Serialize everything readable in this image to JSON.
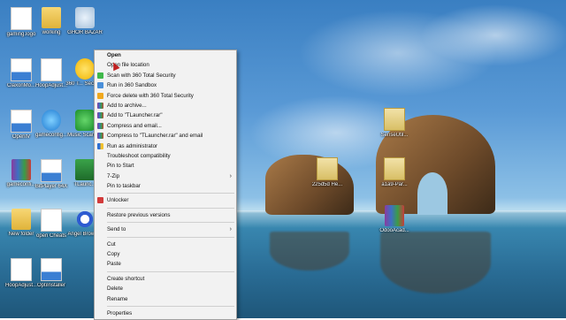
{
  "desktop": {
    "icons": [
      {
        "label": "gaming.logo"
      },
      {
        "label": "working"
      },
      {
        "label": "GHOR\nBAZAR"
      },
      {
        "label": "ClaxonMo..."
      },
      {
        "label": "HoopAdjust..."
      },
      {
        "label": "360 T... Securi..."
      },
      {
        "label": "OpenIV"
      },
      {
        "label": "gameconfig..."
      },
      {
        "label": "Music Scanner"
      },
      {
        "label": "gameconfi..."
      },
      {
        "label": "BitPlayer 64X"
      },
      {
        "label": "TLaunc..."
      },
      {
        "label": "New folder"
      },
      {
        "label": "open Cheats"
      },
      {
        "label": "Angel Browser"
      },
      {
        "label": "HoopAdjust..."
      },
      {
        "label": "OptiInstaller"
      },
      {
        "label": "SenseUtil..."
      },
      {
        "label": "225d5d He..."
      },
      {
        "label": "a1a9-Par..."
      },
      {
        "label": "OdooAcad..."
      }
    ]
  },
  "context_menu": {
    "items": [
      {
        "label": "Open",
        "bold": true
      },
      {
        "label": "Open file location"
      },
      {
        "label": "Scan with 360 Total Security"
      },
      {
        "label": "Run in 360 Sandbox"
      },
      {
        "label": "Force delete with 360 Total Security"
      },
      {
        "label": "Add to archive..."
      },
      {
        "label": "Add to \"TLauncher.rar\""
      },
      {
        "label": "Compress and email..."
      },
      {
        "label": "Compress to \"TLauncher.rar\" and email"
      },
      {
        "label": "Run as administrator"
      },
      {
        "label": "Troubleshoot compatibility"
      },
      {
        "label": "Pin to Start"
      },
      {
        "label": "7-Zip"
      },
      {
        "label": "Pin to taskbar"
      },
      {
        "label": "Unlocker"
      },
      {
        "label": "Restore previous versions"
      },
      {
        "label": "Send to"
      },
      {
        "label": "Cut"
      },
      {
        "label": "Copy"
      },
      {
        "label": "Paste"
      },
      {
        "label": "Create shortcut"
      },
      {
        "label": "Delete"
      },
      {
        "label": "Rename"
      },
      {
        "label": "Properties"
      }
    ],
    "submenu_arrow": "›"
  },
  "colors": {
    "menu_bg": "#f2f2f2",
    "menu_border": "#a0a0a0",
    "sky": "#3a7fc2",
    "sea": "#2a6d96"
  }
}
